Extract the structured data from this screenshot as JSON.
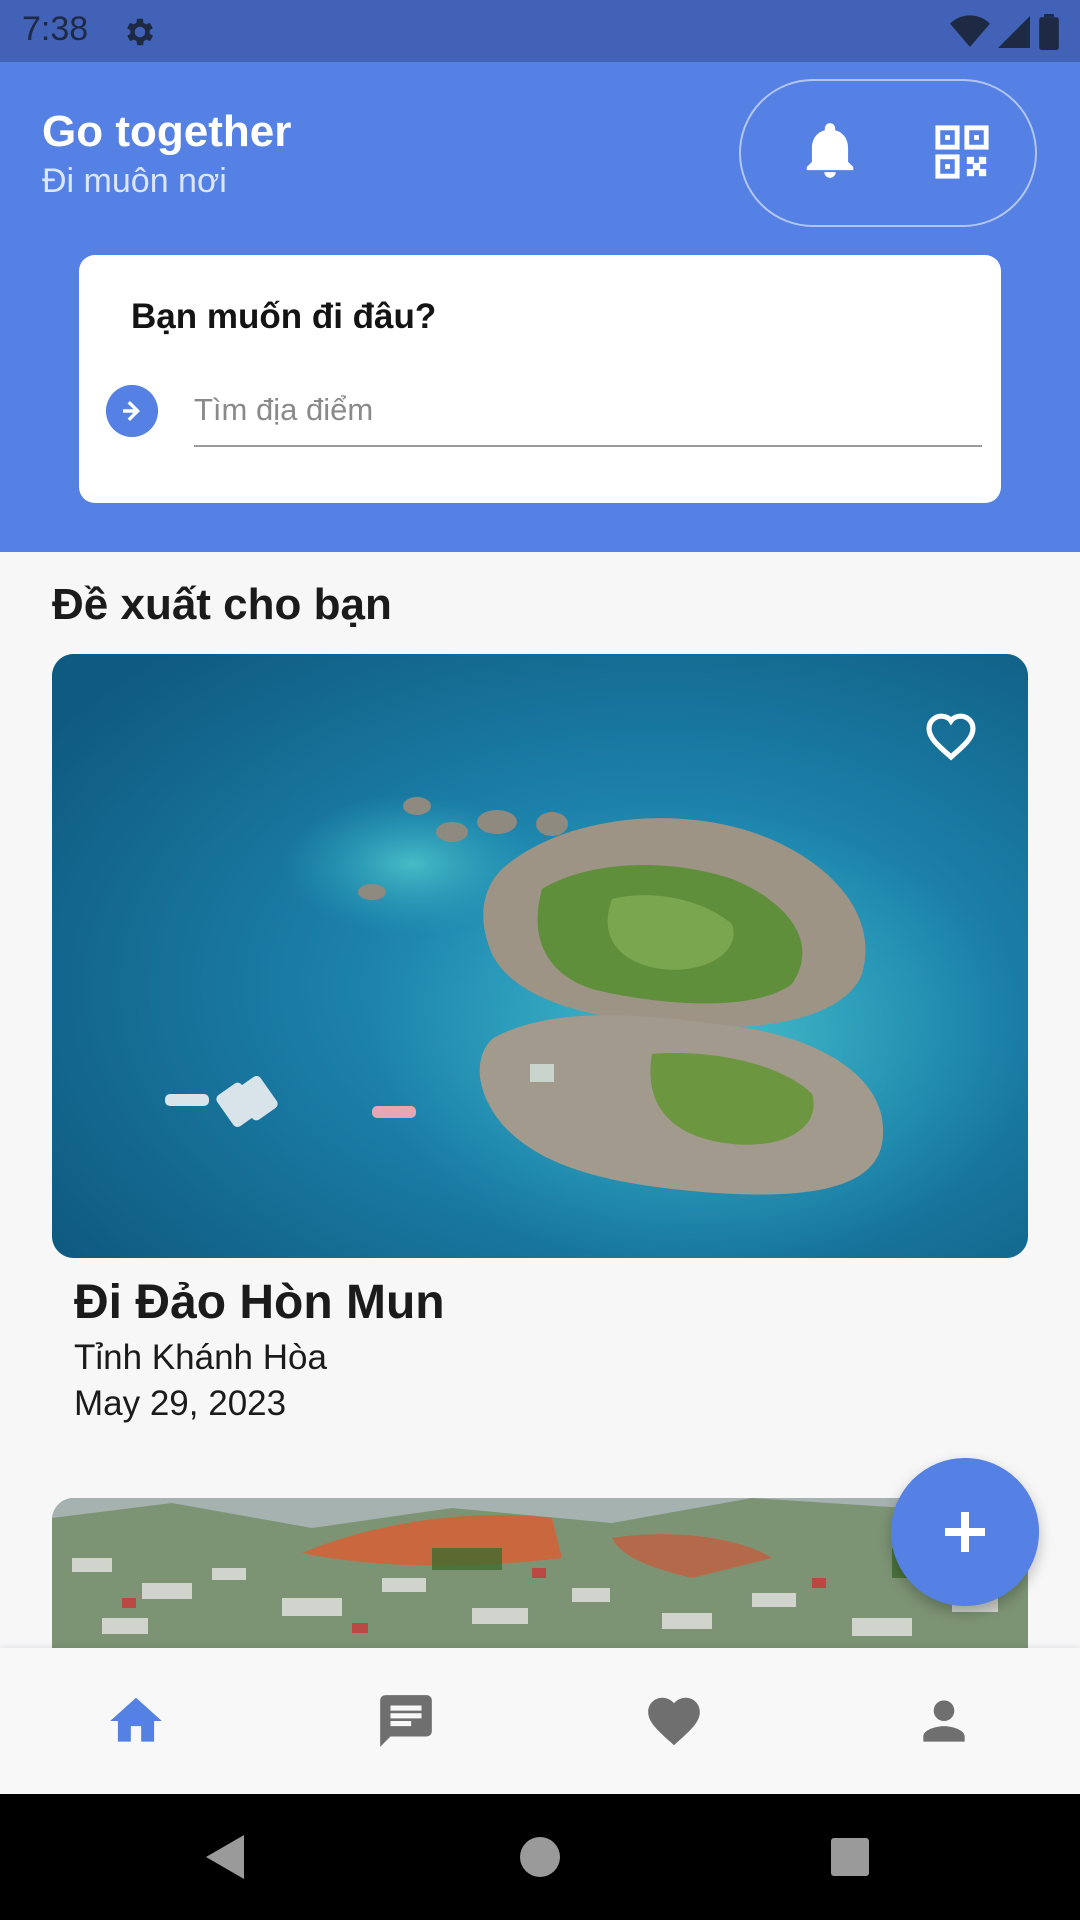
{
  "status_bar": {
    "time": "7:38",
    "icons": [
      "settings-icon",
      "wifi-icon",
      "signal-icon",
      "battery-icon"
    ]
  },
  "header": {
    "title": "Go together",
    "subtitle": "Đi muôn nơi",
    "actions": [
      "bell-icon",
      "qr-code-icon"
    ]
  },
  "search": {
    "title": "Bạn muốn đi đâu?",
    "placeholder": "Tìm địa điểm",
    "value": ""
  },
  "section": {
    "title": "Đề xuất cho bạn"
  },
  "destinations": [
    {
      "name": "Đi Đảo Hòn Mun",
      "province": "Tỉnh Khánh Hòa",
      "date": "May 29, 2023",
      "favorited": false
    }
  ],
  "fab": {
    "icon": "plus-icon"
  },
  "bottom_nav": {
    "items": [
      "home-icon",
      "chat-icon",
      "favorite-icon",
      "person-icon"
    ],
    "active_index": 0
  },
  "system_nav": [
    "back-icon",
    "home-circle-icon",
    "recents-icon"
  ],
  "colors": {
    "primary": "#5580e4",
    "status_bar": "#4262b8",
    "background": "#f7f7f8",
    "nav_active": "#5580e4",
    "nav_inactive": "#6f6f6f"
  }
}
